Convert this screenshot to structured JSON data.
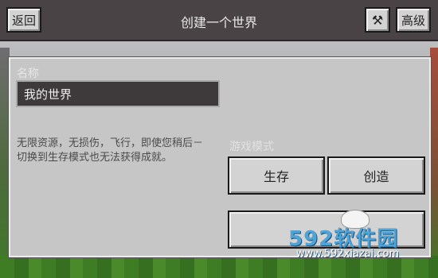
{
  "topbar": {
    "back_label": "返回",
    "title": "创建一个世界",
    "icon_glyph": "⚒",
    "advanced_label": "高级"
  },
  "form": {
    "name_label": "名称",
    "name_value": "我的世界",
    "description": "无限资源，无损伤，飞行，即使您稍后－切换到生存模式也无法获得成就。",
    "mode_label": "游戏模式",
    "survival_label": "生存",
    "creative_label": "创造"
  },
  "watermark": {
    "brand": "592软件园",
    "url": "www.592xiazai.com"
  }
}
